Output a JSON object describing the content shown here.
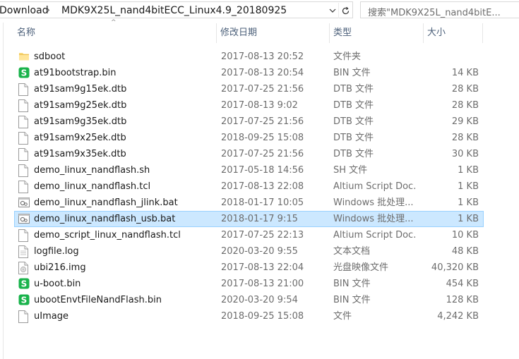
{
  "address": {
    "crumbs": [
      "Download",
      "MDK9X25L_nand4bitECC_Linux4.9_20180925"
    ],
    "separator": "›"
  },
  "search": {
    "placeholder": "搜索\"MDK9X25L_nand4bitE..."
  },
  "columns": {
    "name": "名称",
    "date": "修改日期",
    "type": "类型",
    "size": "大小"
  },
  "files": [
    {
      "name": "sdboot",
      "date": "2017-08-13 20:52",
      "type": "文件夹",
      "size": "",
      "icon": "folder-icon",
      "selected": false
    },
    {
      "name": "at91bootstrap.bin",
      "date": "2017-08-13 20:54",
      "type": "BIN 文件",
      "size": "14 KB",
      "icon": "bin-file-icon",
      "selected": false
    },
    {
      "name": "at91sam9g15ek.dtb",
      "date": "2017-07-25 21:56",
      "type": "DTB 文件",
      "size": "28 KB",
      "icon": "file-icon",
      "selected": false
    },
    {
      "name": "at91sam9g25ek.dtb",
      "date": "2017-08-13 9:02",
      "type": "DTB 文件",
      "size": "28 KB",
      "icon": "file-icon",
      "selected": false
    },
    {
      "name": "at91sam9g35ek.dtb",
      "date": "2017-07-25 21:56",
      "type": "DTB 文件",
      "size": "29 KB",
      "icon": "file-icon",
      "selected": false
    },
    {
      "name": "at91sam9x25ek.dtb",
      "date": "2018-09-25 15:08",
      "type": "DTB 文件",
      "size": "28 KB",
      "icon": "file-icon",
      "selected": false
    },
    {
      "name": "at91sam9x35ek.dtb",
      "date": "2017-07-25 21:56",
      "type": "DTB 文件",
      "size": "30 KB",
      "icon": "file-icon",
      "selected": false
    },
    {
      "name": "demo_linux_nandflash.sh",
      "date": "2017-05-18 14:56",
      "type": "SH 文件",
      "size": "1 KB",
      "icon": "file-icon",
      "selected": false
    },
    {
      "name": "demo_linux_nandflash.tcl",
      "date": "2017-08-13 22:08",
      "type": "Altium Script Doc...",
      "size": "1 KB",
      "icon": "file-icon",
      "selected": false
    },
    {
      "name": "demo_linux_nandflash_jlink.bat",
      "date": "2018-01-17 10:05",
      "type": "Windows 批处理...",
      "size": "1 KB",
      "icon": "batch-file-icon",
      "selected": false
    },
    {
      "name": "demo_linux_nandflash_usb.bat",
      "date": "2018-01-17 9:15",
      "type": "Windows 批处理...",
      "size": "1 KB",
      "icon": "batch-file-icon",
      "selected": true
    },
    {
      "name": "demo_script_linux_nandflash.tcl",
      "date": "2017-07-25 22:13",
      "type": "Altium Script Doc...",
      "size": "10 KB",
      "icon": "file-icon",
      "selected": false
    },
    {
      "name": "logfile.log",
      "date": "2020-03-20 9:55",
      "type": "文本文档",
      "size": "48 KB",
      "icon": "text-file-icon",
      "selected": false
    },
    {
      "name": "ubi216.img",
      "date": "2017-08-13 22:04",
      "type": "光盘映像文件",
      "size": "40,320 KB",
      "icon": "disc-image-icon",
      "selected": false
    },
    {
      "name": "u-boot.bin",
      "date": "2017-08-13 21:00",
      "type": "BIN 文件",
      "size": "454 KB",
      "icon": "bin-file-icon",
      "selected": false
    },
    {
      "name": "ubootEnvtFileNandFlash.bin",
      "date": "2020-03-20 9:54",
      "type": "BIN 文件",
      "size": "128 KB",
      "icon": "bin-file-icon",
      "selected": false
    },
    {
      "name": "uImage",
      "date": "2018-09-25 15:08",
      "type": "文件",
      "size": "4,242 KB",
      "icon": "file-icon",
      "selected": false
    }
  ]
}
